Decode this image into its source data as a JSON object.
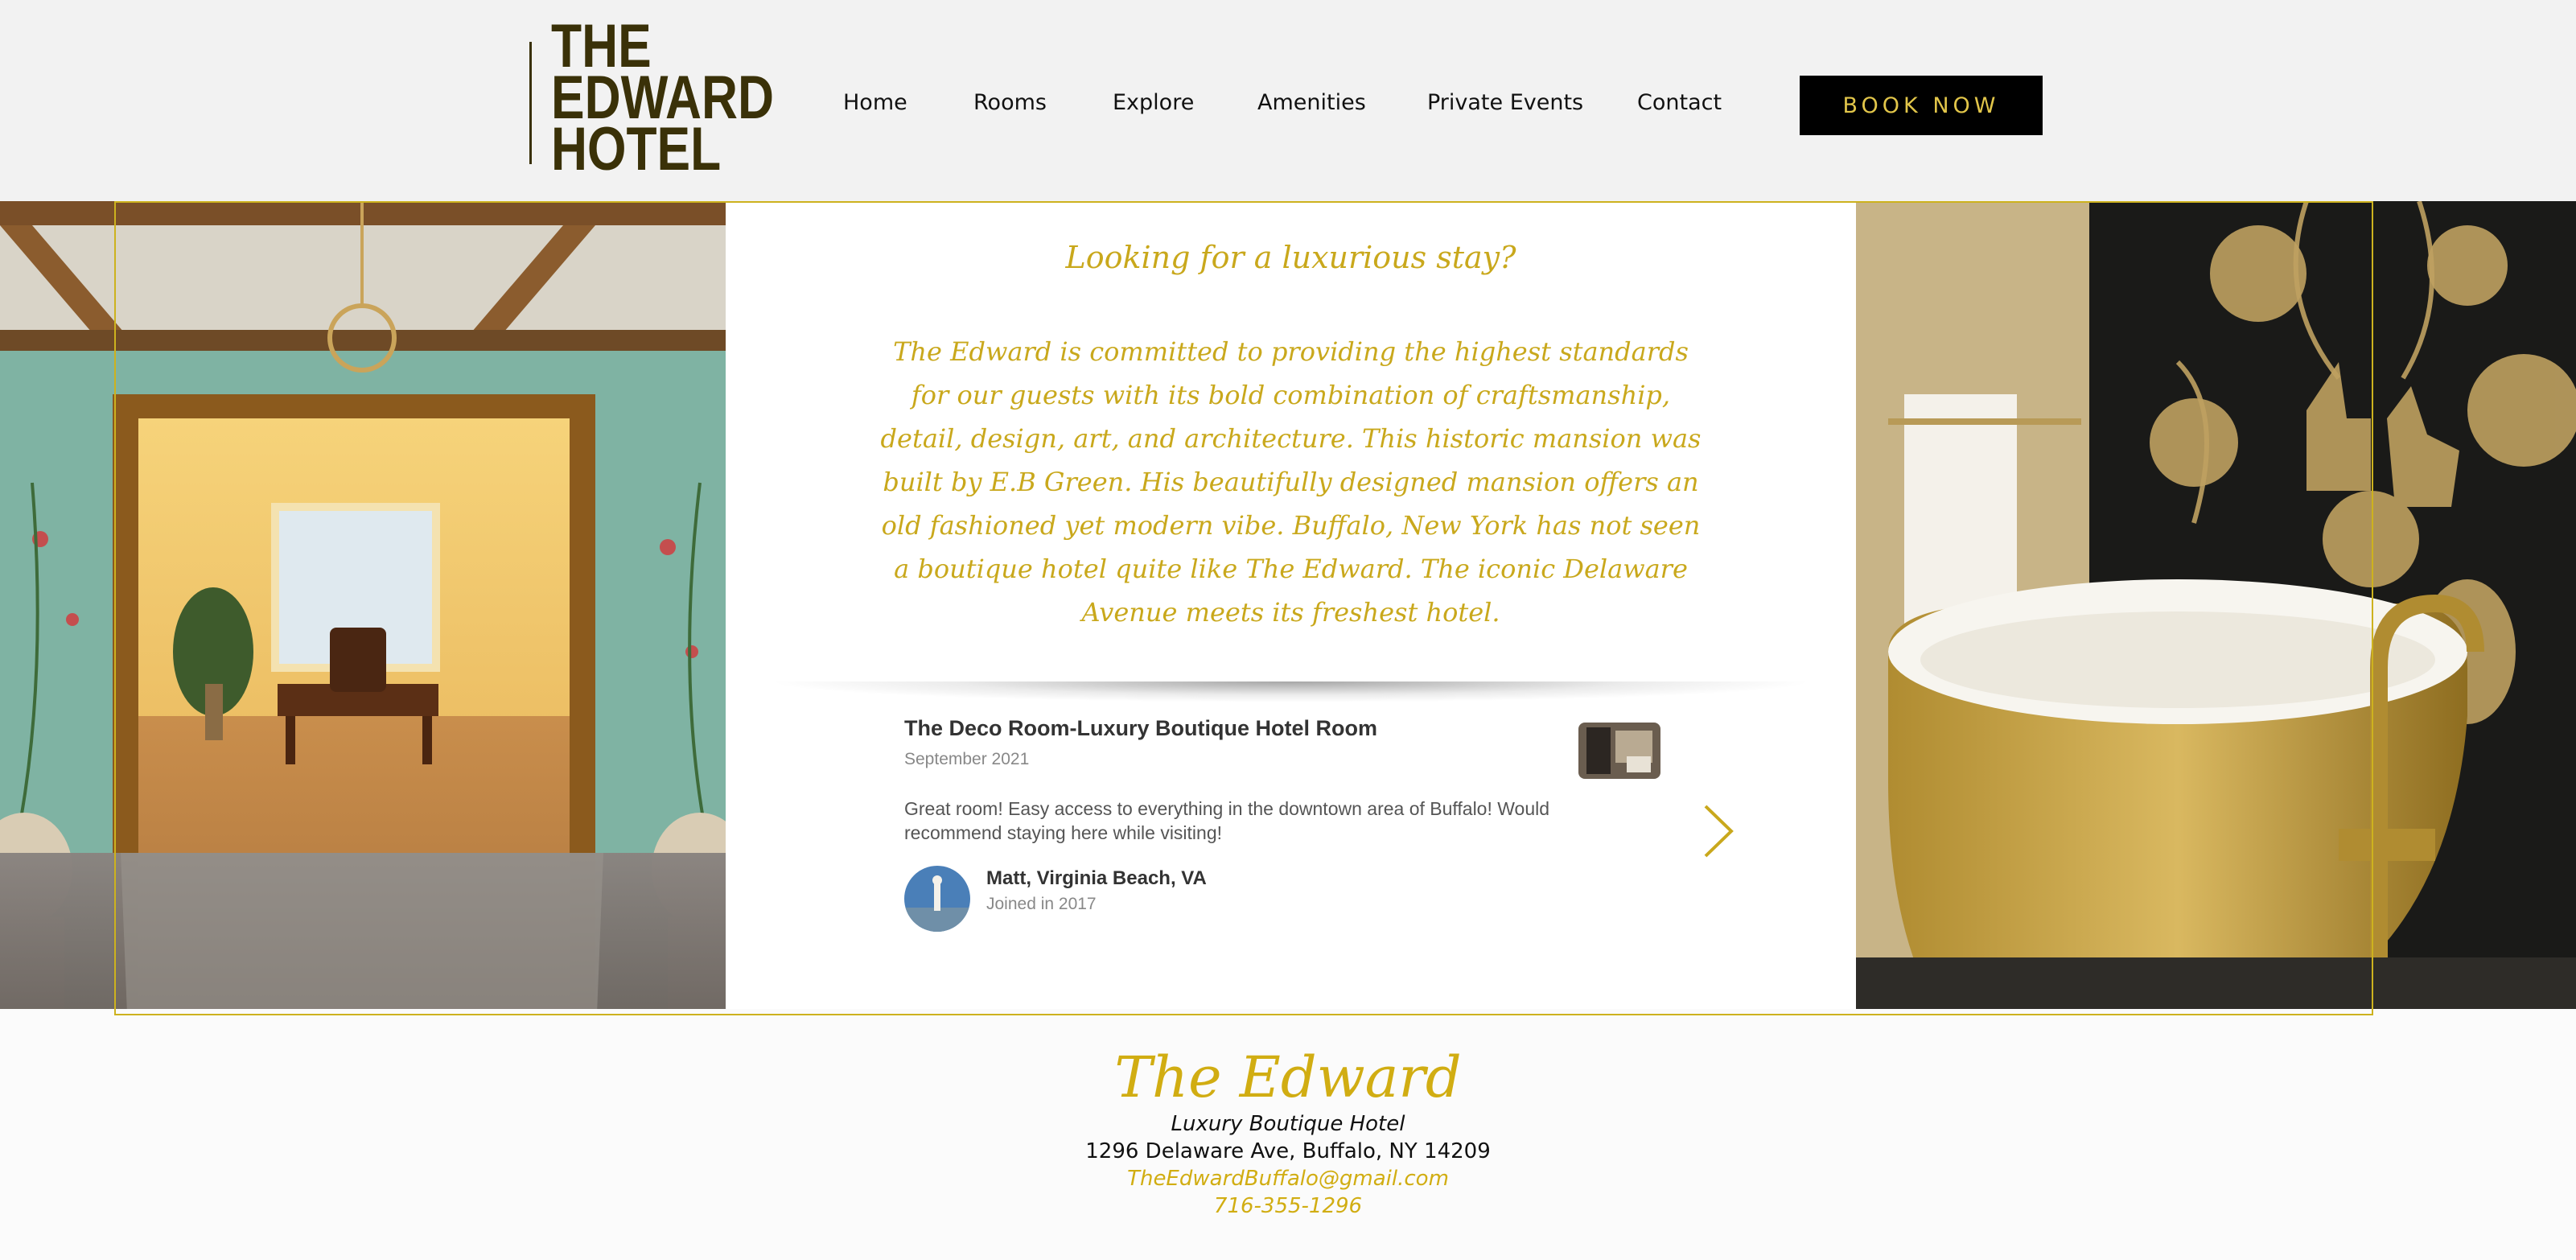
{
  "header": {
    "logo_lines": [
      "THE",
      "EDWARD",
      "HOTEL"
    ],
    "nav": [
      "Home",
      "Rooms",
      "Explore",
      "Amenities",
      "Private Events",
      "Contact"
    ],
    "book_button": "BOOK NOW"
  },
  "intro": {
    "title": "Looking for a luxurious stay?",
    "body": "The Edward is committed to providing the highest standards for our guests with its bold combination of craftsmanship, detail, design, art, and architecture. This historic mansion was built by E.B Green. His beautifully designed mansion offers an old fashioned yet modern vibe. Buffalo, New York has not seen a boutique hotel quite like The Edward. The iconic Delaware Avenue meets its freshest hotel."
  },
  "review": {
    "title": "The Deco Room-Luxury Boutique Hotel Room",
    "date": "September 2021",
    "text": "Great room! Easy access to everything in the downtown area of Buffalo! Would recommend staying here while visiting!",
    "reviewer_name": "Matt, Virginia Beach, VA",
    "reviewer_joined": "Joined in 2017"
  },
  "footer": {
    "brand": "The Edward",
    "tagline": "Luxury Boutique Hotel",
    "address": "1296 Delaware Ave, Buffalo, NY 14209",
    "email": "TheEdwardBuffalo@gmail.com",
    "phone": "716-355-1296"
  },
  "colors": {
    "gold": "#c9a81c",
    "logo_dark": "#3a3108",
    "button_bg": "#000000",
    "button_text": "#e2c64a"
  },
  "icons": [
    "chevron-right-icon"
  ]
}
